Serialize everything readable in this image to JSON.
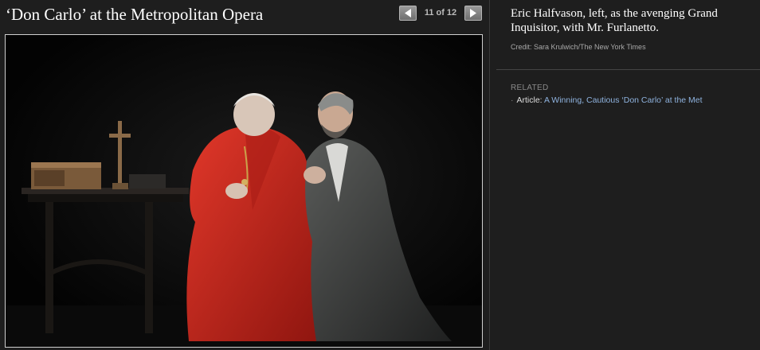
{
  "slideshow": {
    "title": "‘Don Carlo’ at the Metropolitan Opera",
    "counter": "11 of 12",
    "prev_icon": "arrow-left-icon",
    "next_icon": "arrow-right-icon"
  },
  "caption": {
    "text": "Eric Halfvason,  left, as the avenging Grand Inquisitor, with Mr. Furlanetto.",
    "credit": "Credit: Sara Krulwich/The New York Times"
  },
  "related": {
    "heading": "RELATED",
    "bullet": "·",
    "label": "Article:",
    "link_text": "A Winning, Cautious ‘Don Carlo’ at the Met"
  },
  "colors": {
    "background": "#1e1e1e",
    "link": "#8fb3df",
    "robe_red": "#c8261c",
    "robe_gray": "#3f4140"
  }
}
